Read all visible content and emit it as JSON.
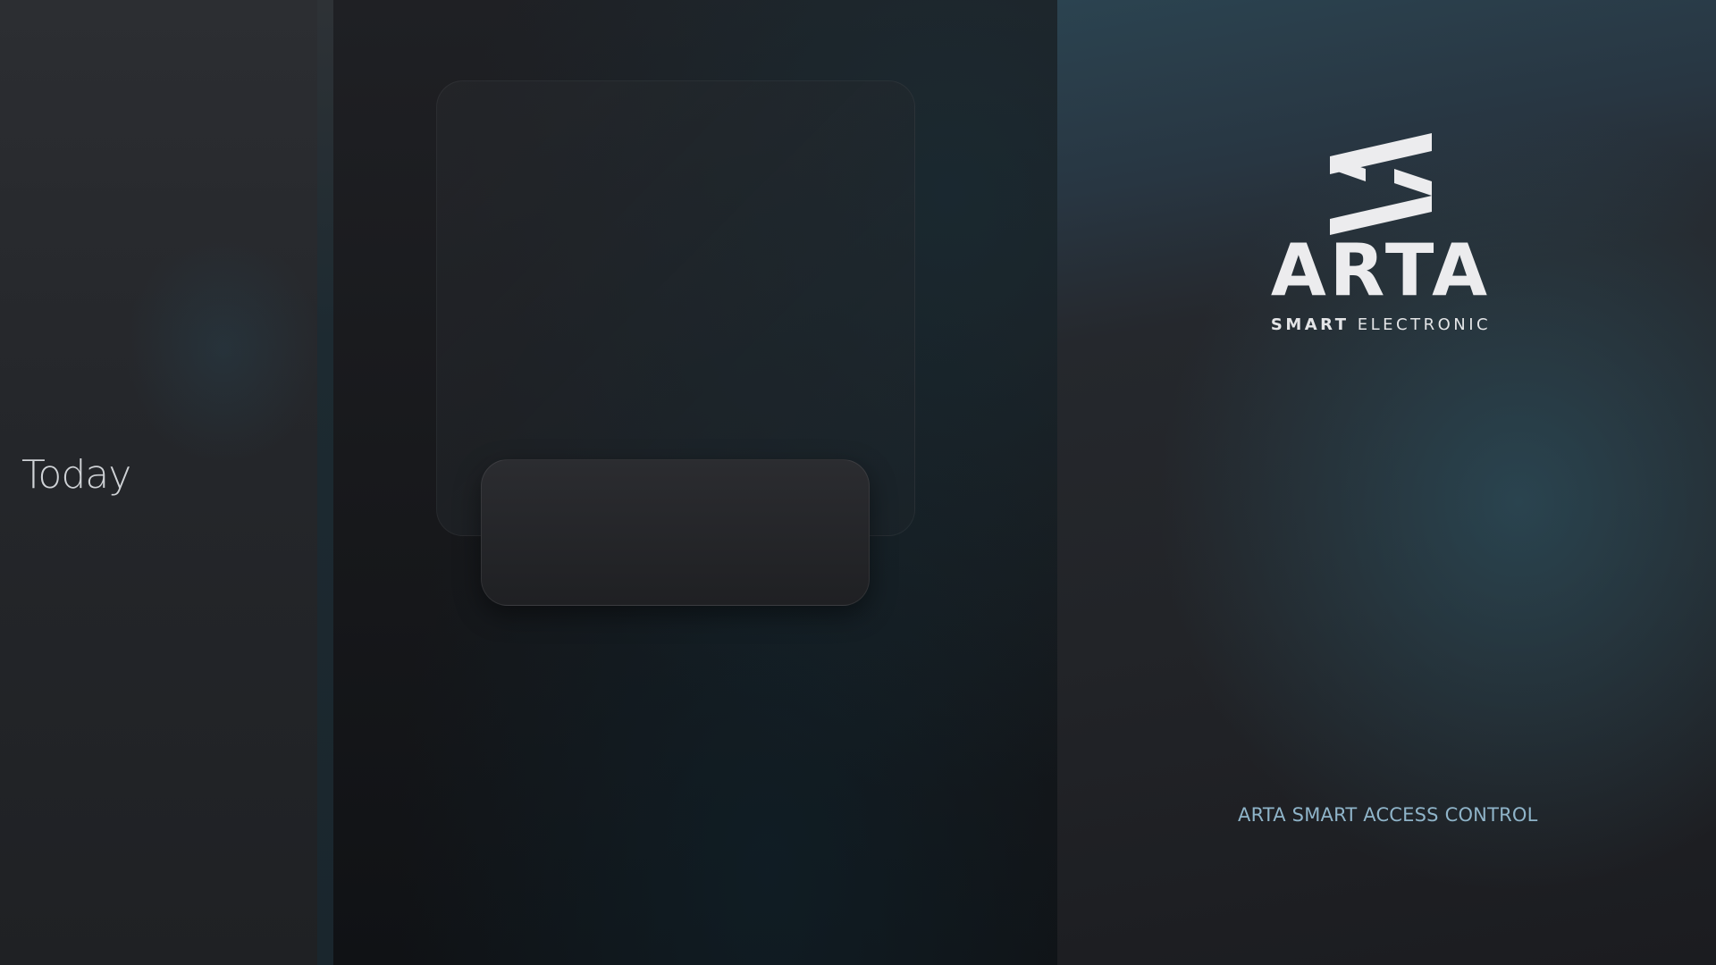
{
  "left_panel": {
    "date_label": "Today"
  },
  "branding": {
    "name": "ARTA",
    "tagline_bold": "SMART",
    "tagline_light": "ELECTRONIC",
    "caption": "ARTA SMART ACCESS CONTROL",
    "logo_icon": "arta-mark-icon"
  },
  "colors": {
    "caption_text": "#8fb4c9",
    "brand_text": "#ececee",
    "panel_accent": "#2b4350"
  }
}
